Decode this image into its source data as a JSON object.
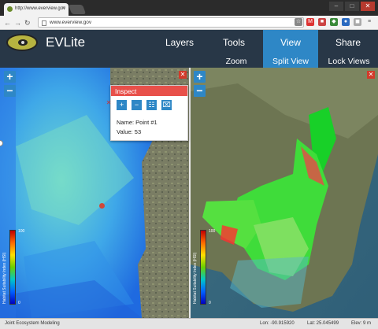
{
  "browser": {
    "tab_title": "http://www.everview.gov",
    "url": "www.everview.gov",
    "controls": [
      "–",
      "□",
      "✕"
    ]
  },
  "app": {
    "title": "EVLite",
    "menu": [
      "Layers",
      "Tools",
      "View",
      "Share"
    ],
    "active_menu": "View",
    "submenu": [
      "Zoom",
      "Split View",
      "Lock Views"
    ],
    "active_submenu": "Split View",
    "accent": "#2e87c6",
    "header_bg": "#283747"
  },
  "left_map": {
    "zoom_in": "+",
    "zoom_out": "−",
    "close": "✕",
    "legend_max": "100",
    "legend_min": "0",
    "legend_title": "Habitat Suitability Index (HSI)"
  },
  "right_map": {
    "zoom_in": "+",
    "zoom_out": "−",
    "close": "✕",
    "legend_max": "100",
    "legend_min": "0",
    "legend_title": "Habitat Suitability Index (HSI)"
  },
  "inspect": {
    "title": "Inspect",
    "close": "✕",
    "tools": [
      "+",
      "−",
      "☷",
      "⌧"
    ],
    "name_line": "Name: Point #1",
    "value_line": "Value: 53"
  },
  "status": {
    "credit": "Joint Ecosystem Modeling",
    "lon": "Lon: -90.915920",
    "lat": "Lat: 25.045499",
    "elev": "Elev: 9 m"
  }
}
